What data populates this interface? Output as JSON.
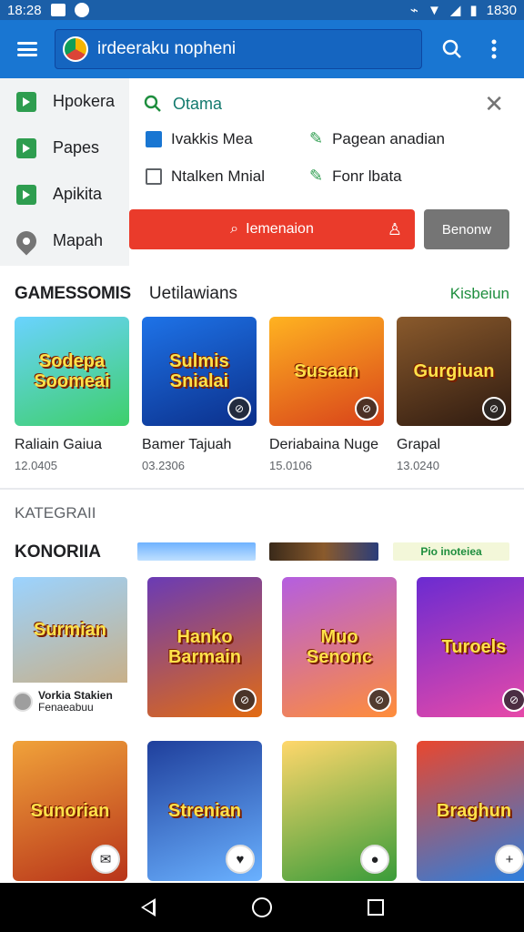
{
  "status_bar": {
    "time": "18:28",
    "right_text": "1830"
  },
  "app_bar": {
    "search_text": "irdeeraku nopheni",
    "search_icon": "search-icon",
    "more_icon": "more-vert-icon"
  },
  "drawer": {
    "items": [
      {
        "label": "Hpokera",
        "icon": "play-icon"
      },
      {
        "label": "Papes",
        "icon": "play-icon"
      },
      {
        "label": "Apikita",
        "icon": "play-icon"
      },
      {
        "label": "Mapah",
        "icon": "map-pin-icon"
      }
    ]
  },
  "filter_panel": {
    "search_label": "Otama",
    "options": [
      {
        "label": "Ivakkis Mea",
        "checked": true,
        "type": "checkbox"
      },
      {
        "label": "Pagean anadian",
        "type": "edit"
      },
      {
        "label": "Ntalken Mnial",
        "checked": false,
        "type": "checkbox"
      },
      {
        "label": "Fonr lbata",
        "type": "edit"
      }
    ],
    "primary_button": "Iemenaion",
    "secondary_button": "Benonw"
  },
  "section_games": {
    "title": "GAMESSOMIS",
    "subtitle": "Uetilawians",
    "more": "Kisbeiun",
    "cards": [
      {
        "name": "Raliain Gaiua",
        "meta": "12.0405",
        "art": "Sodepa Soomeai",
        "colors": [
          "#6ad3ff",
          "#3ecf6a"
        ],
        "badge": ""
      },
      {
        "name": "Bamer Tajuah",
        "meta": "03.2306",
        "art": "Sulmis Snialai",
        "colors": [
          "#1e73e8",
          "#0b2f8a"
        ],
        "badge": ""
      },
      {
        "name": "Deriabaina Nuge",
        "meta": "15.0106",
        "art": "Susaan",
        "colors": [
          "#ffb321",
          "#d8421a"
        ],
        "badge": ""
      },
      {
        "name": "Grapal",
        "meta": "13.0240",
        "art": "Gurgiuan",
        "colors": [
          "#8a5a2c",
          "#2e1a10"
        ],
        "badge": ""
      }
    ]
  },
  "section_categories": {
    "label": "KATEGRAII",
    "title": "KONORIIA",
    "strip_text": "Pio inoteiea",
    "cards": [
      {
        "art": "Surmian",
        "colors": [
          "#9bd3ff",
          "#c8b089"
        ],
        "dev_name": "Vorkia Stakien",
        "dev_sub": "Fenaeabuu",
        "fab": ""
      },
      {
        "art": "Hanko Barmain",
        "colors": [
          "#6a3bb5",
          "#e26b12"
        ],
        "fab": ""
      },
      {
        "art": "Muo Senonc",
        "colors": [
          "#b45ee0",
          "#ff8d3a"
        ],
        "fab": ""
      },
      {
        "art": "Turoels",
        "colors": [
          "#6b2bd1",
          "#e84aa8"
        ],
        "fab": ""
      },
      {
        "art": "Sunorian",
        "colors": [
          "#f0a23a",
          "#b8341a"
        ],
        "fab": "✉"
      },
      {
        "art": "Strenian",
        "colors": [
          "#1f3f9c",
          "#6ab1ff"
        ],
        "fab": "♥"
      },
      {
        "art": "",
        "colors": [
          "#ffd76b",
          "#3a9c3a"
        ],
        "fab": "●"
      },
      {
        "art": "Braghun",
        "colors": [
          "#e9472e",
          "#2a7fe0"
        ],
        "fab": "+"
      }
    ]
  },
  "colors": {
    "app_bar": "#1976d2",
    "accent_green": "#1e8e3e",
    "primary_red": "#ea3b2b"
  }
}
